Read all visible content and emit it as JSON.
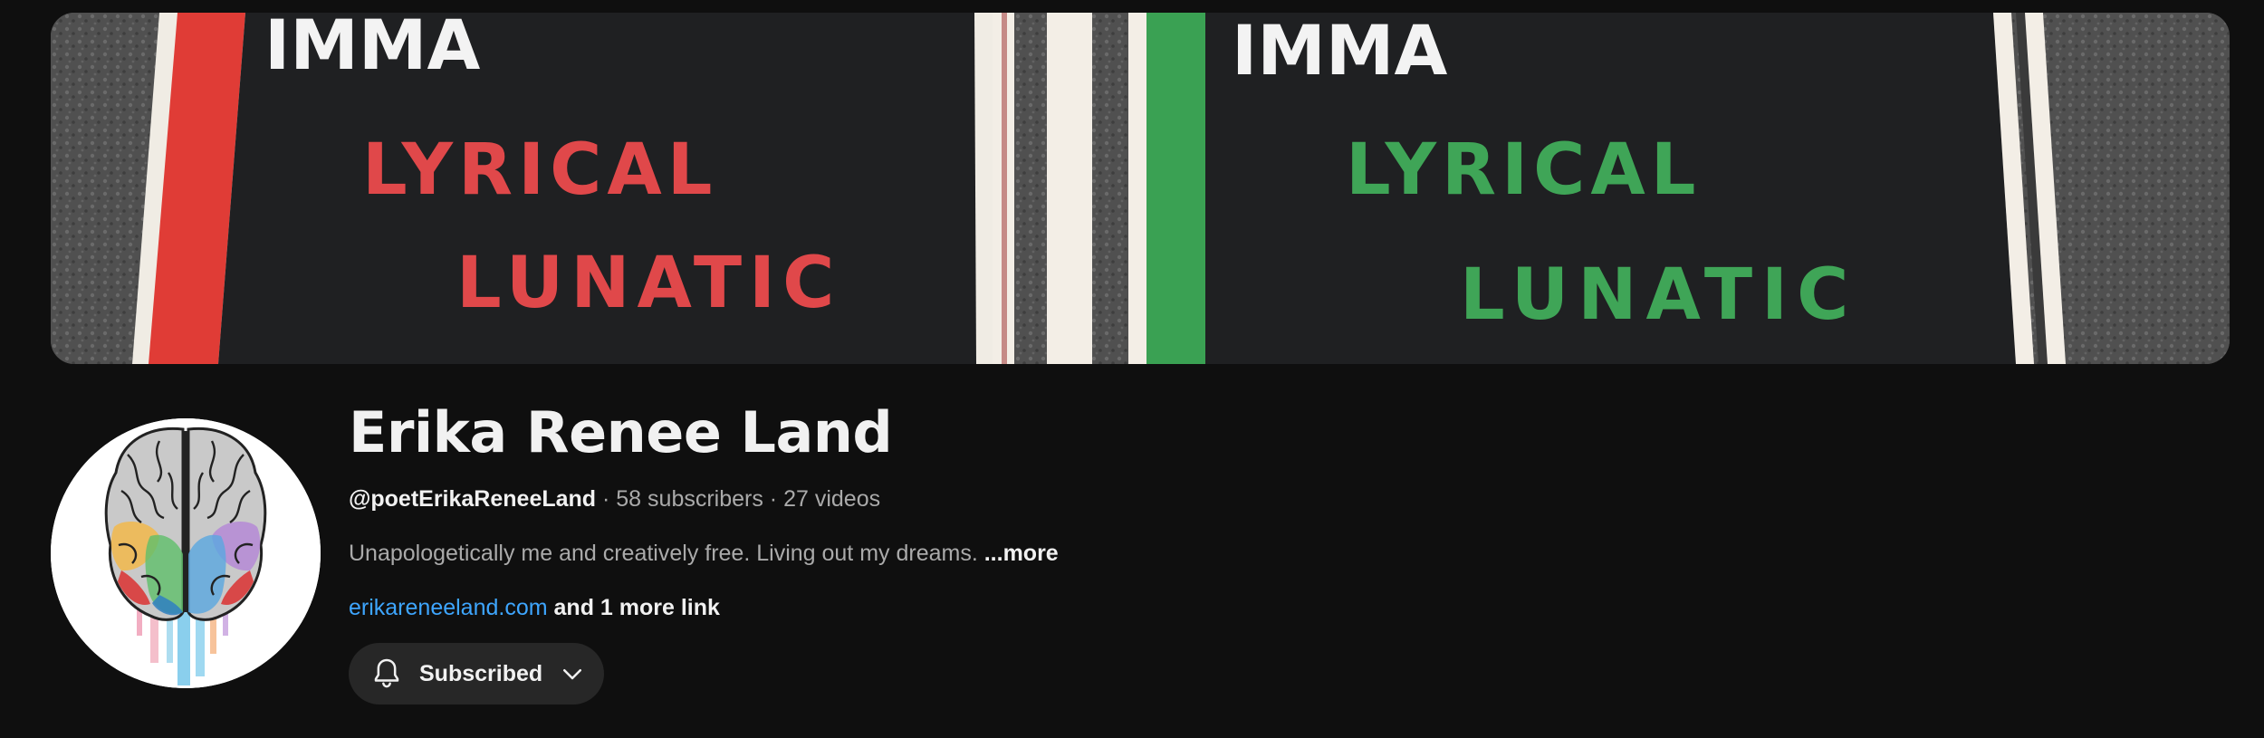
{
  "banner": {
    "left_panel": {
      "line1": "IMMA",
      "line2": "LYRICAL",
      "line3": "LUNATIC",
      "text_color": "#e0484a",
      "stripe_color": "#e03c36"
    },
    "right_panel": {
      "line1": "IMMA",
      "line2": "LYRICAL",
      "line3": "LUNATIC",
      "text_color": "#3fa557",
      "stripe_color": "#3aa153"
    }
  },
  "avatar": {
    "icon": "brain-watercolor-icon"
  },
  "channel": {
    "name": "Erika Renee Land",
    "handle": "@poetErikaReneeLand",
    "separator": " · ",
    "subscribers": "58 subscribers",
    "videos": "27 videos",
    "description": "Unapologetically me and creatively free. Living out my dreams.",
    "more_label": "...more",
    "link": "erikareneeland.com",
    "more_links": "and 1 more link"
  },
  "subscribe": {
    "label": "Subscribed",
    "bell_icon": "bell-icon",
    "dropdown_icon": "chevron-down-icon"
  },
  "colors": {
    "background": "#0f0f0f",
    "link": "#3ea6ff",
    "secondary_text": "#aaaaaa",
    "button_bg": "#272727"
  }
}
